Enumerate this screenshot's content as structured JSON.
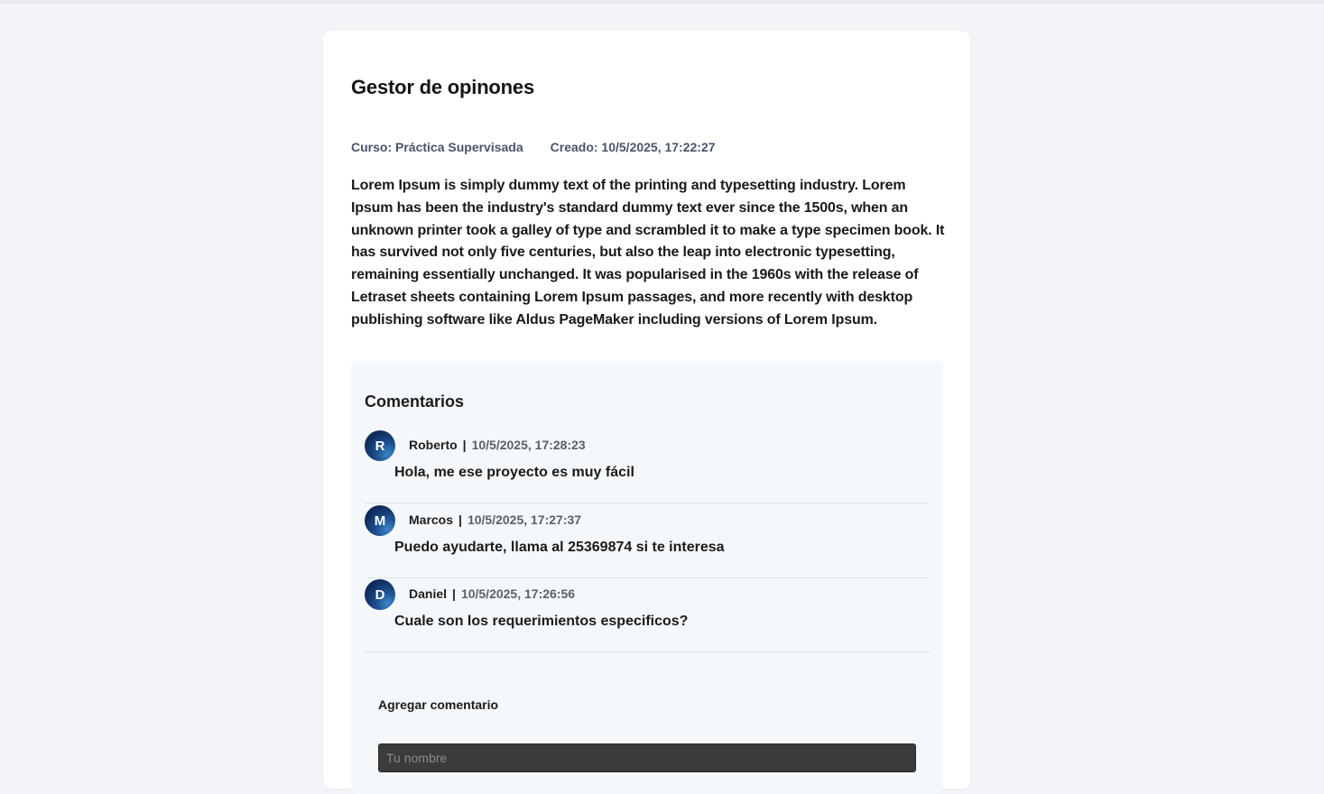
{
  "post": {
    "title": "Gestor de opinones",
    "course": "Curso: Práctica Supervisada",
    "created": "Creado: 10/5/2025, 17:22:27",
    "description": "Lorem Ipsum is simply dummy text of the printing and typesetting industry. Lorem Ipsum has been the industry's standard dummy text ever since the 1500s, when an unknown printer took a galley of type and scrambled it to make a type specimen book. It has survived not only five centuries, but also the leap into electronic typesetting, remaining essentially unchanged. It was popularised in the 1960s with the release of Letraset sheets containing Lorem Ipsum passages, and more recently with desktop publishing software like Aldus PageMaker including versions of Lorem Ipsum."
  },
  "comments": {
    "title": "Comentarios",
    "separator": "|",
    "items": [
      {
        "initial": "R",
        "author": "Roberto",
        "date": "10/5/2025, 17:28:23",
        "text": "Hola, me ese proyecto es muy fácil"
      },
      {
        "initial": "M",
        "author": "Marcos",
        "date": "10/5/2025, 17:27:37",
        "text": "Puedo ayudarte, llama al 25369874 si te interesa"
      },
      {
        "initial": "D",
        "author": "Daniel",
        "date": "10/5/2025, 17:26:56",
        "text": "Cuale son los requerimientos especificos?"
      }
    ]
  },
  "add_comment": {
    "label": "Agregar comentario",
    "name_placeholder": "Tu nombre",
    "name_value": ""
  },
  "colors": {
    "page_background": "#f3f4f8",
    "card_background": "#ffffff",
    "comments_background": "#f5f8fb",
    "avatar": "#0f2d5e",
    "input_background": "#3b3b3b"
  }
}
